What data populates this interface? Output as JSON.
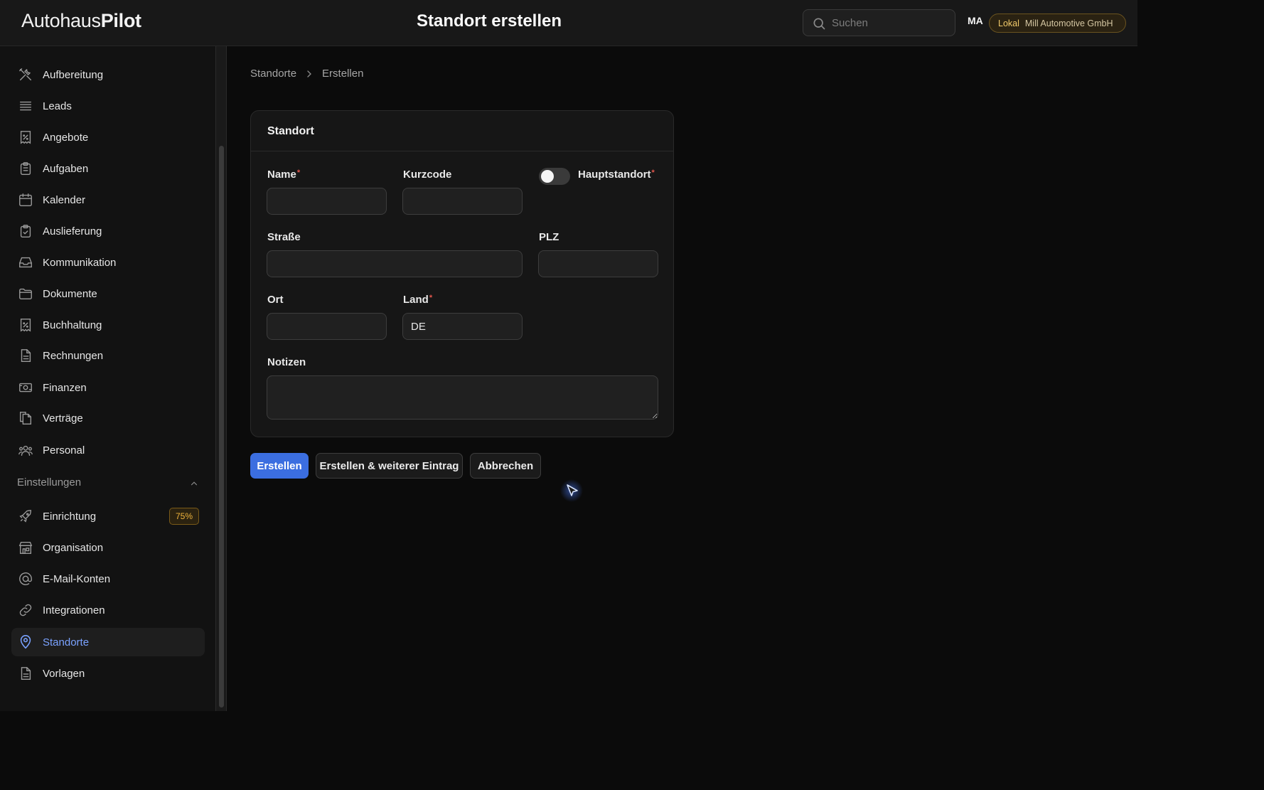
{
  "header": {
    "logo_light": "Autohaus",
    "logo_bold": "Pilot",
    "title": "Standort erstellen",
    "search_placeholder": "Suchen",
    "avatar": "MA",
    "env_label": "Lokal",
    "org_label": "Mill Automotive GmbH"
  },
  "sidebar": {
    "items": [
      {
        "label": "Aufbereitung",
        "icon": "tools-icon"
      },
      {
        "label": "Leads",
        "icon": "list-icon"
      },
      {
        "label": "Angebote",
        "icon": "receipt-percent-icon"
      },
      {
        "label": "Aufgaben",
        "icon": "clipboard-list-icon"
      },
      {
        "label": "Kalender",
        "icon": "calendar-icon"
      },
      {
        "label": "Auslieferung",
        "icon": "clipboard-check-icon"
      },
      {
        "label": "Kommunikation",
        "icon": "inbox-icon"
      },
      {
        "label": "Dokumente",
        "icon": "folder-icon"
      },
      {
        "label": "Buchhaltung",
        "icon": "receipt-percent-icon"
      },
      {
        "label": "Rechnungen",
        "icon": "document-icon"
      },
      {
        "label": "Finanzen",
        "icon": "banknote-icon"
      },
      {
        "label": "Verträge",
        "icon": "documents-icon"
      },
      {
        "label": "Personal",
        "icon": "users-icon"
      }
    ],
    "settings_group": "Einstellungen",
    "settings_items": [
      {
        "label": "Einrichtung",
        "icon": "rocket-icon",
        "badge": "75%"
      },
      {
        "label": "Organisation",
        "icon": "building-icon"
      },
      {
        "label": "E-Mail-Konten",
        "icon": "at-icon"
      },
      {
        "label": "Integrationen",
        "icon": "link-icon"
      },
      {
        "label": "Standorte",
        "icon": "map-pin-icon",
        "active": true
      },
      {
        "label": "Vorlagen",
        "icon": "document-icon"
      }
    ]
  },
  "breadcrumb": [
    "Standorte",
    "Erstellen"
  ],
  "form": {
    "section_title": "Standort",
    "name_label": "Name",
    "name_value": "",
    "shortcode_label": "Kurzcode",
    "shortcode_value": "",
    "main_location_label": "Hauptstandort",
    "main_location_on": false,
    "street_label": "Straße",
    "street_value": "",
    "zip_label": "PLZ",
    "zip_value": "",
    "city_label": "Ort",
    "city_value": "",
    "country_label": "Land",
    "country_value": "DE",
    "notes_label": "Notizen",
    "notes_value": "",
    "required_mark": "*"
  },
  "actions": {
    "create": "Erstellen",
    "create_another": "Erstellen & weiterer Eintrag",
    "cancel": "Abbrechen"
  },
  "colors": {
    "accent": "#3b6ee0",
    "active_nav": "#7aa2ff",
    "required": "#e2564c",
    "badge": "#f0b43c"
  }
}
